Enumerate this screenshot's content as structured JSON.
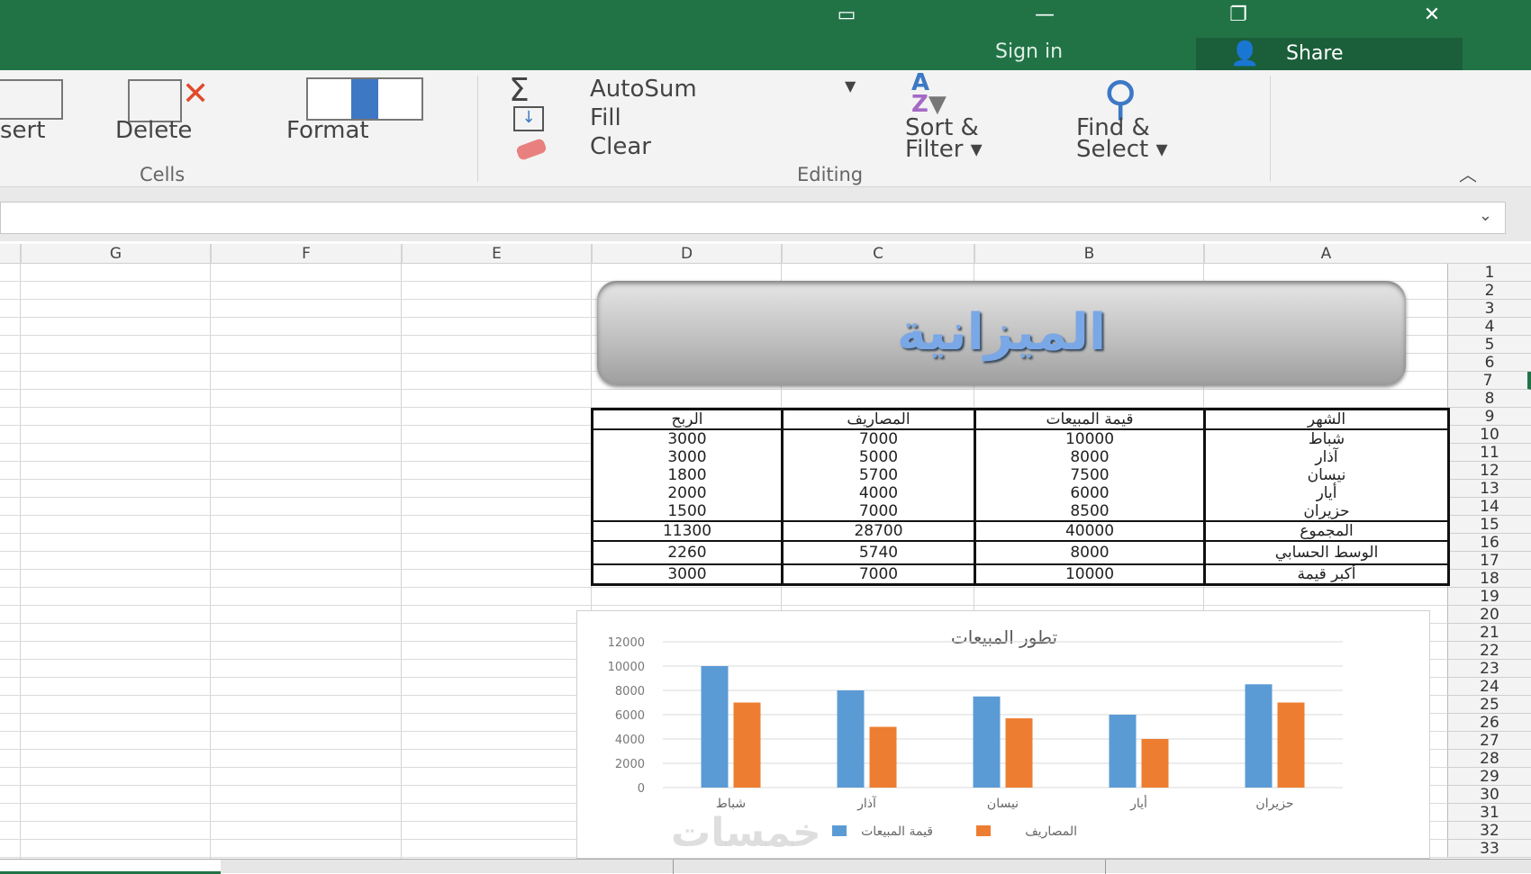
{
  "window": {
    "controls": [
      "ribbon-display-icon",
      "minimize-icon",
      "restore-icon",
      "close-icon"
    ],
    "sign_in": "Sign in",
    "share": "Share"
  },
  "ribbon": {
    "cells": {
      "insert": "sert",
      "delete": "Delete",
      "format": "Format",
      "group": "Cells"
    },
    "editing": {
      "autosum": "AutoSum",
      "fill": "Fill",
      "clear": "Clear",
      "sort_filter_1": "Sort &",
      "sort_filter_2": "Filter",
      "find_select_1": "Find &",
      "find_select_2": "Select",
      "group": "Editing"
    }
  },
  "columns": [
    "G",
    "F",
    "E",
    "D",
    "C",
    "B",
    "A"
  ],
  "banner": {
    "title": "الميزانية"
  },
  "table": {
    "headers": [
      "الربح",
      "المصاريف",
      "قيمة المبيعات",
      "الشهر"
    ],
    "rows": [
      [
        "3000",
        "7000",
        "10000",
        "شباط"
      ],
      [
        "3000",
        "5000",
        "8000",
        "آذار"
      ],
      [
        "1800",
        "5700",
        "7500",
        "نيسان"
      ],
      [
        "2000",
        "4000",
        "6000",
        "أيار"
      ],
      [
        "1500",
        "7000",
        "8500",
        "حزيران"
      ]
    ],
    "total": [
      "11300",
      "28700",
      "40000",
      "المجموع"
    ],
    "average": [
      "2260",
      "5740",
      "8000",
      "الوسط الحسابي"
    ],
    "max": [
      "3000",
      "7000",
      "10000",
      "أكبر قيمة"
    ]
  },
  "chart_data": {
    "type": "bar",
    "title": "تطور المبيعات",
    "categories": [
      "شباط",
      "آذار",
      "نيسان",
      "أيار",
      "حزيران"
    ],
    "series": [
      {
        "name": "قيمة المبيعات",
        "values": [
          10000,
          8000,
          7500,
          6000,
          8500
        ],
        "color": "#5b9bd5"
      },
      {
        "name": "المصاريف",
        "values": [
          7000,
          5000,
          5700,
          4000,
          7000
        ],
        "color": "#ed7d31"
      }
    ],
    "yticks": [
      "0",
      "2000",
      "4000",
      "6000",
      "8000",
      "10000",
      "12000"
    ],
    "ylim": [
      0,
      12000
    ],
    "grid": true,
    "legend": "bottom"
  },
  "colors": {
    "titlebar": "#217346"
  }
}
